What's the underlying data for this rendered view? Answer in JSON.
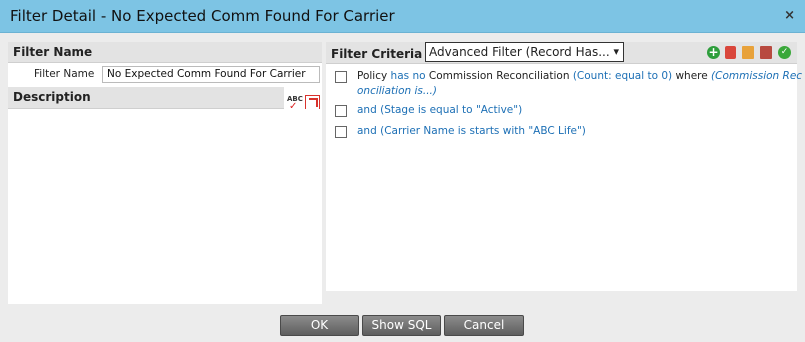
{
  "dialog": {
    "title": "Filter Detail - No Expected Comm Found For Carrier",
    "close_label": "×"
  },
  "filter_name_section": {
    "heading": "Filter Name",
    "field_label": "Filter Name",
    "field_value": "No Expected Comm Found For Carrier"
  },
  "description_section": {
    "heading": "Description",
    "spellcheck_label": "ABC",
    "value": ""
  },
  "criteria_section": {
    "heading": "Filter Criteria",
    "filter_type_selected": "Advanced Filter (Record Has...",
    "rows": [
      {
        "p1": "Policy ",
        "p2": "has no",
        "p3": " Commission Reconciliation ",
        "p4": "(Count: equal to 0)",
        "p5": " where ",
        "p6": "(Commission Rec",
        "p7": "onciliation is...)"
      },
      {
        "text": "and (Stage is equal to \"Active\")"
      },
      {
        "text": "and (Carrier Name is starts with \"ABC Life\")"
      }
    ]
  },
  "buttons": {
    "ok": "OK",
    "show_sql": "Show SQL",
    "cancel": "Cancel"
  },
  "colors": {
    "titlebar": "#7dc4e4",
    "link_blue": "#1c6fb5",
    "button_gray": "#6e6e6e"
  }
}
